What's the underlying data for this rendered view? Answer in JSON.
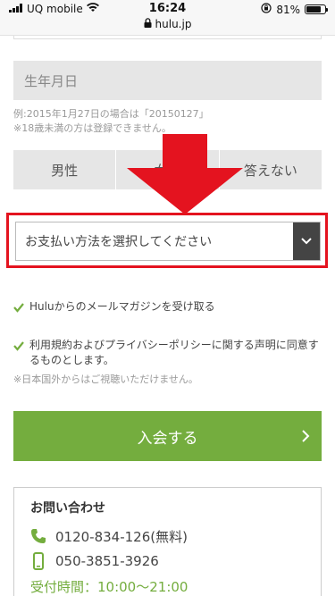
{
  "status_bar": {
    "carrier": "UQ mobile",
    "time": "16:24",
    "url": "hulu.jp",
    "battery": "81%",
    "battery_level": 0.81
  },
  "form": {
    "birthdate_placeholder": "生年月日",
    "birthdate_note": "例:2015年1月27日の場合は「20150127」",
    "age_note": "※18歳未満の方は登録できません。",
    "gender_options": [
      "男性",
      "女性",
      "答えない"
    ],
    "payment_select_label": "お支払い方法を選択してください",
    "newsletter_label": "Huluからのメールマガジンを受け取る",
    "terms_label": "利用規約およびプライバシーポリシーに関する声明に同意するものとします。",
    "overseas_note": "※日本国外からはご視聴いただけません。",
    "join_button": "入会する"
  },
  "contact": {
    "title": "お問い合わせ",
    "phone_free": "0120-834-126(無料)",
    "phone_mobile": "050-3851-3926",
    "hours": "受付時間：10:00〜21:00"
  },
  "colors": {
    "accent_green": "#74ad3e",
    "highlight_red": "#e4131f"
  }
}
